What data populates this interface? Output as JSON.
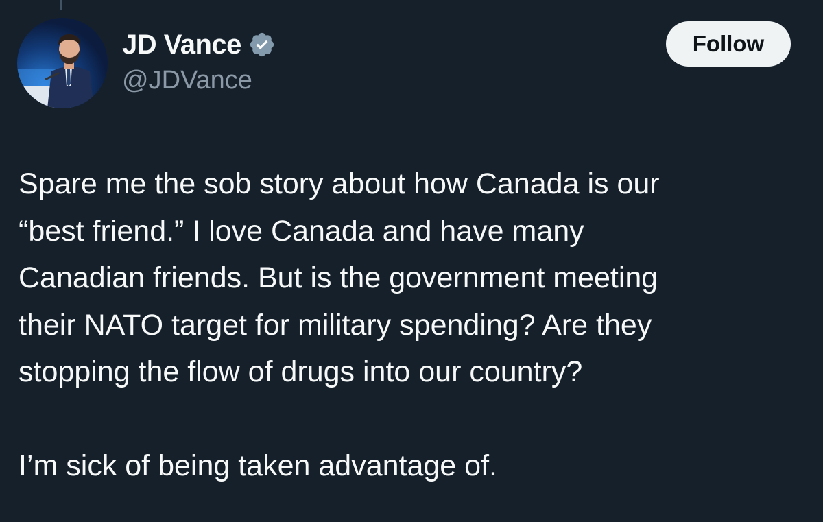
{
  "author": {
    "display_name": "JD Vance",
    "handle": "@JDVance",
    "verified": true,
    "verified_icon": "verified-badge-icon",
    "avatar": "profile-photo-man-in-suit-at-podium"
  },
  "actions": {
    "follow_label": "Follow"
  },
  "tweet": {
    "paragraphs": [
      {
        "lines": [
          "Spare me the sob story about how Canada is our",
          "“best friend.” I love Canada and have many",
          "Canadian friends. But is the government meeting",
          "their NATO target for military spending? Are they",
          "stopping the flow of drugs into our country?"
        ]
      },
      {
        "lines": [
          "I’m sick of being taken advantage of."
        ]
      }
    ]
  },
  "colors": {
    "background": "#15202b",
    "text_primary": "#f7f9f9",
    "text_secondary": "#8b98a5",
    "follow_button_bg": "#eff3f4",
    "follow_button_text": "#0f1419",
    "verified_badge": "#829aab"
  }
}
